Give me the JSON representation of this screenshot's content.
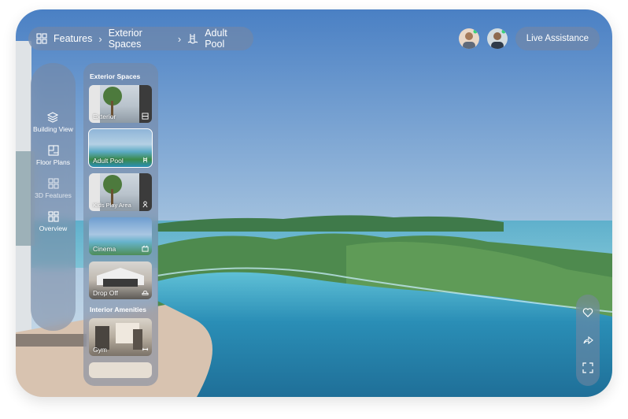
{
  "breadcrumb": {
    "items": [
      "Features",
      "Exterior Spaces",
      "Adult Pool"
    ]
  },
  "header": {
    "live_label": "Live Assistance"
  },
  "sidebar": {
    "items": [
      {
        "label": "Building View",
        "icon": "layers-icon"
      },
      {
        "label": "Floor Plans",
        "icon": "floor-plan-icon"
      },
      {
        "label": "3D Features",
        "icon": "grid-icon"
      },
      {
        "label": "Overview",
        "icon": "dashboard-icon"
      }
    ]
  },
  "panel": {
    "section1_title": "Exterior Spaces",
    "exterior": [
      {
        "label": "Exterior",
        "icon": "building-icon"
      },
      {
        "label": "Adult Pool",
        "icon": "pool-icon",
        "selected": true
      },
      {
        "label": "Kids Play Area",
        "icon": "kids-icon"
      },
      {
        "label": "Cinema",
        "icon": "cinema-icon"
      },
      {
        "label": "Drop Off",
        "icon": "car-icon"
      }
    ],
    "section2_title": "Interior Amenities",
    "interior": [
      {
        "label": "Gym",
        "icon": "dumbbell-icon"
      }
    ]
  },
  "colors": {
    "sky_top": "#4f86c8",
    "sky_bottom": "#c9dcea",
    "sea": "#6cb8d1",
    "pool": "#2c8fb3",
    "glass_panel": "#7887a0"
  }
}
